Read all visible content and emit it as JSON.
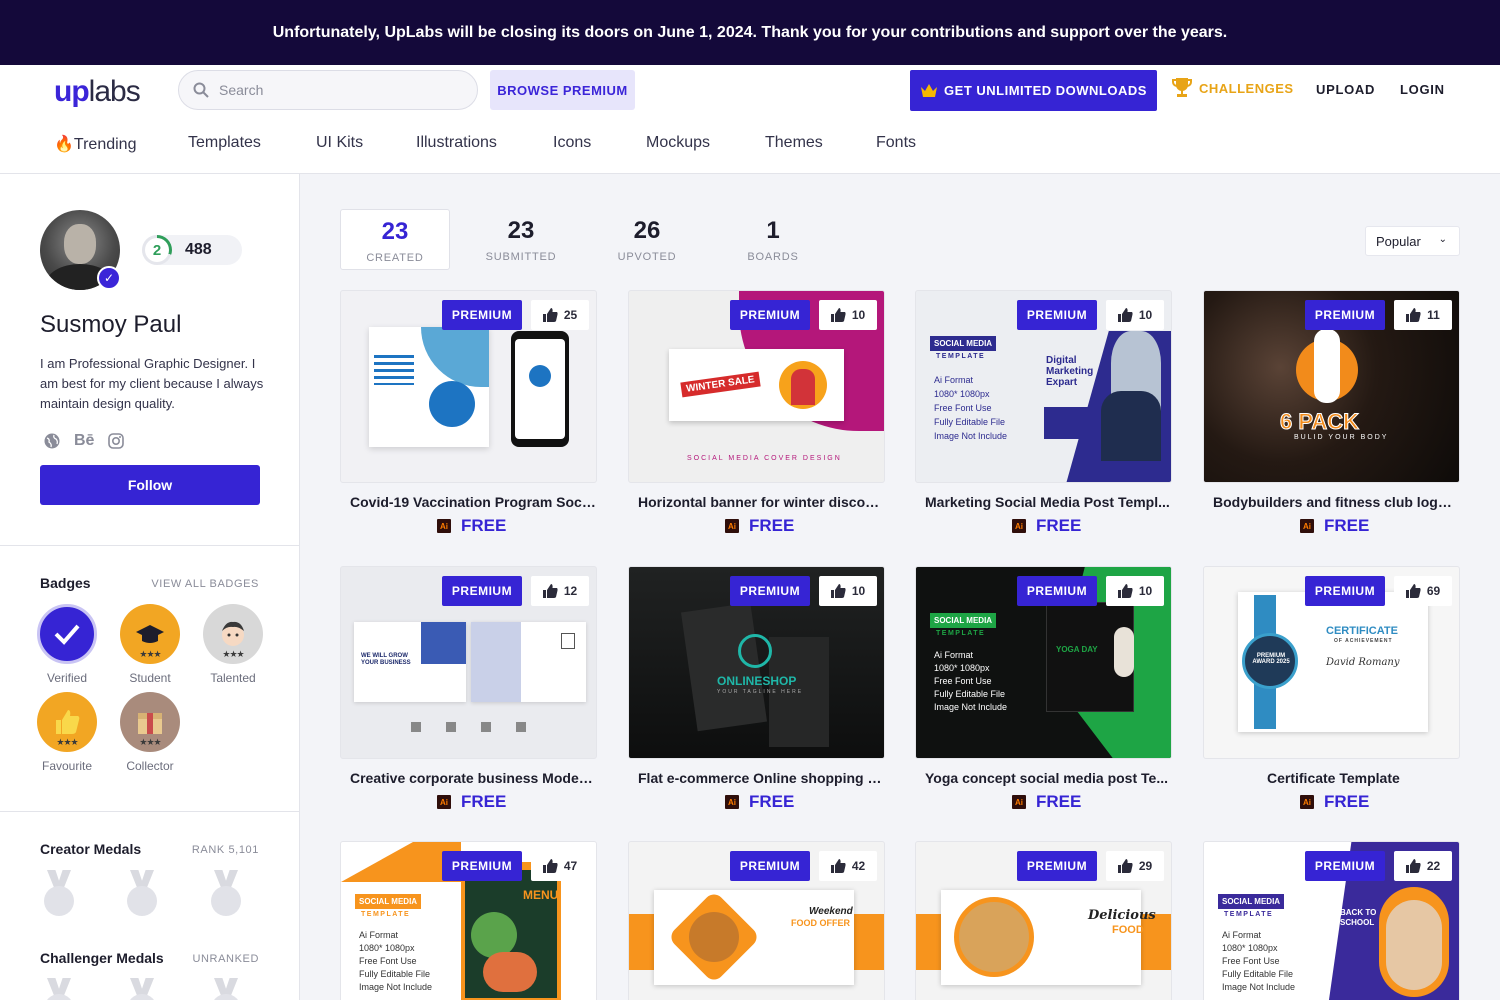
{
  "banner": {
    "text": "Unfortunately, UpLabs will be closing its doors on June 1, 2024. Thank you for your contributions and support over the years."
  },
  "header": {
    "logo_up": "up",
    "logo_labs": "labs",
    "search_placeholder": "Search",
    "browse_premium": "BROWSE PREMIUM",
    "unlimited_downloads": "GET UNLIMITED DOWNLOADS",
    "challenges": "CHALLENGES",
    "upload": "UPLOAD",
    "login": "LOGIN"
  },
  "nav": [
    {
      "label": "🔥Trending"
    },
    {
      "label": "Templates"
    },
    {
      "label": "UI Kits"
    },
    {
      "label": "Illustrations"
    },
    {
      "label": "Icons"
    },
    {
      "label": "Mockups"
    },
    {
      "label": "Themes"
    },
    {
      "label": "Fonts"
    }
  ],
  "profile": {
    "level": "2",
    "points": "488",
    "name": "Susmoy Paul",
    "bio": "I am Professional Graphic Designer. I am best for my client because I always maintain design quality.",
    "socials": [
      "globe-icon",
      "behance-icon",
      "instagram-icon"
    ],
    "behance_text": "Bē",
    "follow": "Follow"
  },
  "badges": {
    "title": "Badges",
    "link": "VIEW ALL BADGES",
    "items": [
      {
        "label": "Verified",
        "icon": "checkmark-icon",
        "color": "#3624d4"
      },
      {
        "label": "Student",
        "icon": "graduation-cap-icon",
        "color": "#f2a623"
      },
      {
        "label": "Talented",
        "icon": "face-icon",
        "color": "#d8d8d8"
      },
      {
        "label": "Favourite",
        "icon": "thumbs-up-icon",
        "color": "#f2a623"
      },
      {
        "label": "Collector",
        "icon": "box-icon",
        "color": "#a98b7c"
      }
    ]
  },
  "creator_medals": {
    "title": "Creator Medals",
    "rank": "RANK 5,101"
  },
  "challenger_medals": {
    "title": "Challenger Medals",
    "rank": "UNRANKED"
  },
  "stats": [
    {
      "value": "23",
      "label": "CREATED"
    },
    {
      "value": "23",
      "label": "SUBMITTED"
    },
    {
      "value": "26",
      "label": "UPVOTED"
    },
    {
      "value": "1",
      "label": "BOARDS"
    }
  ],
  "sort": {
    "selected": "Popular"
  },
  "cards": [
    {
      "title": "Covid-19 Vaccination Program Soci...",
      "likes": "25",
      "price": "FREE",
      "badge": "PREMIUM",
      "file_type": "Ai"
    },
    {
      "title": "Horizontal banner for winter discou...",
      "likes": "10",
      "price": "FREE",
      "badge": "PREMIUM",
      "file_type": "Ai"
    },
    {
      "title": "Marketing Social Media Post Templ...",
      "likes": "10",
      "price": "FREE",
      "badge": "PREMIUM",
      "file_type": "Ai"
    },
    {
      "title": "Bodybuilders and fitness club logo t...",
      "likes": "11",
      "price": "FREE",
      "badge": "PREMIUM",
      "file_type": "Ai"
    },
    {
      "title": "Creative corporate business Modern...",
      "likes": "12",
      "price": "FREE",
      "badge": "PREMIUM",
      "file_type": "Ai"
    },
    {
      "title": "Flat e-commerce Online shopping m...",
      "likes": "10",
      "price": "FREE",
      "badge": "PREMIUM",
      "file_type": "Ai"
    },
    {
      "title": "Yoga concept social media post Te...",
      "likes": "10",
      "price": "FREE",
      "badge": "PREMIUM",
      "file_type": "Ai"
    },
    {
      "title": "Certificate Template",
      "likes": "69",
      "price": "FREE",
      "badge": "PREMIUM",
      "file_type": "Ai"
    },
    {
      "title": "",
      "likes": "47",
      "price": "",
      "badge": "PREMIUM",
      "file_type": ""
    },
    {
      "title": "",
      "likes": "42",
      "price": "",
      "badge": "PREMIUM",
      "file_type": ""
    },
    {
      "title": "",
      "likes": "29",
      "price": "",
      "badge": "PREMIUM",
      "file_type": ""
    },
    {
      "title": "",
      "likes": "22",
      "price": "",
      "badge": "PREMIUM",
      "file_type": ""
    }
  ],
  "artwork": {
    "c2_sale": "WINTER SALE",
    "c2_caption": "SOCIAL MEDIA COVER DESIGN",
    "c3_template": "SOCIAL MEDIA",
    "c3_template2": "TEMPLATE",
    "c3_list": [
      "Ai Format",
      "1080* 1080px",
      "Free Font Use",
      "Fully Editable File",
      "Image Not Include"
    ],
    "c3_headline": "Digital Marketing Expart",
    "c4_main": "6 PACK",
    "c4_sub": "BULID YOUR BODY",
    "c5_headline": "WE WILL GROW YOUR BUSINESS",
    "c6_brand": "ONLINESHOP",
    "c6_tag": "YOUR TAGLINE HERE",
    "c7_yoga": "YOGA DAY",
    "c8_cert": "CERTIFICATE",
    "c8_sub": "OF ACHIEVEMENT",
    "c8_name": "David Romany",
    "c8_award": "PREMIUM AWARD 2025",
    "c9_menu": "MENU",
    "c10_head": "Weekend",
    "c10_sub": "FOOD OFFER",
    "c11_head": "Delicious",
    "c11_sub": "FOOD",
    "c12_head": "BACK TO SCHOOL"
  },
  "colors": {
    "brand": "#3624d4",
    "banner": "#14093a",
    "challenge": "#e8a417",
    "food_orange": "#f7941d"
  }
}
